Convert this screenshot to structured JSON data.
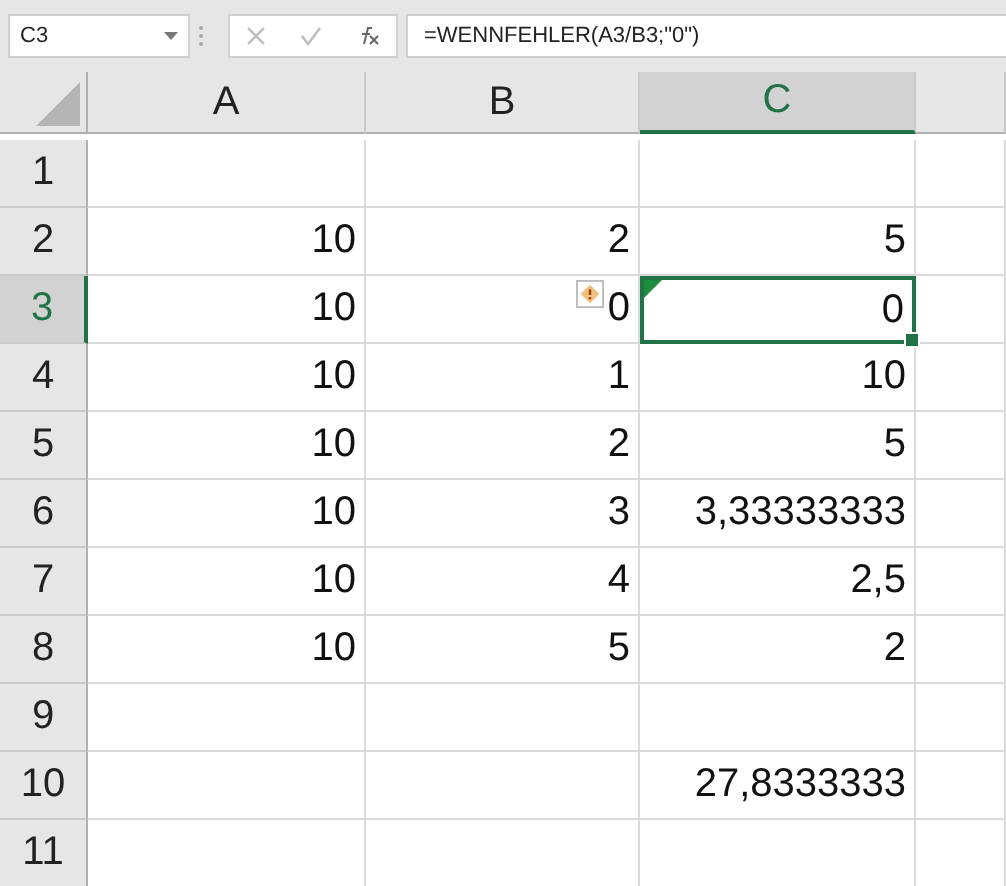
{
  "name_box": "C3",
  "formula": "=WENNFEHLER(A3/B3;\"0\")",
  "columns": [
    {
      "label": "A",
      "selected": false
    },
    {
      "label": "B",
      "selected": false
    },
    {
      "label": "C",
      "selected": true
    }
  ],
  "rows": [
    {
      "label": "1",
      "selected": false,
      "cells": []
    },
    {
      "label": "2",
      "selected": false,
      "cells": [
        "10",
        "2",
        "5"
      ]
    },
    {
      "label": "3",
      "selected": true,
      "cells": [
        "10",
        "0",
        "0"
      ],
      "error_flag": true
    },
    {
      "label": "4",
      "selected": false,
      "cells": [
        "10",
        "1",
        "10"
      ]
    },
    {
      "label": "5",
      "selected": false,
      "cells": [
        "10",
        "2",
        "5"
      ]
    },
    {
      "label": "6",
      "selected": false,
      "cells": [
        "10",
        "3",
        "3,33333333"
      ]
    },
    {
      "label": "7",
      "selected": false,
      "cells": [
        "10",
        "4",
        "2,5"
      ]
    },
    {
      "label": "8",
      "selected": false,
      "cells": [
        "10",
        "5",
        "2"
      ]
    },
    {
      "label": "9",
      "selected": false,
      "cells": []
    },
    {
      "label": "10",
      "selected": false,
      "cells": [
        "",
        "",
        "27,8333333"
      ]
    },
    {
      "label": "11",
      "selected": false,
      "cells": []
    }
  ]
}
